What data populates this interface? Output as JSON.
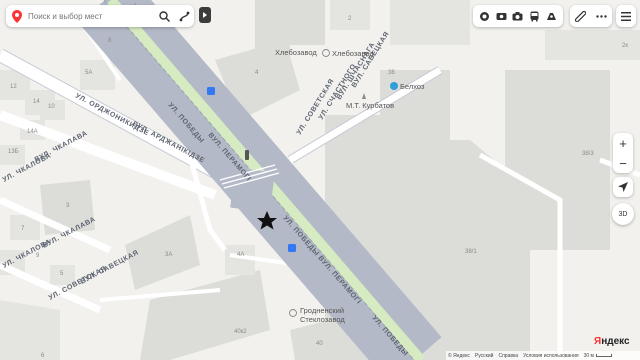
{
  "search": {
    "placeholder": "Поиск и выбор мест"
  },
  "map": {
    "streets": {
      "pobedy_1": "УЛ. ПОБЕДЫ",
      "pobedy_2": "ВУЛ. ПЕРАМОГІ",
      "pobedy_3": "УЛ. ПОБЕДЫ",
      "pobedy_4": "ВУЛ. ПЕРАМОГІ",
      "pobedy_5": "УЛ. ПОБЕДЫ",
      "ordzhonikidze": "УЛ. ОРДЖОНИКИДЗЕ",
      "ardzhanikidze": "ВУЛ. АРДЖАНІКІДЗЕ",
      "chkalova": "УЛ. ЧКАЛОВА",
      "chkalava": "ВУЛ. ЧКАЛАВА",
      "sovetskaya": "УЛ. СОВЕТСКАЯ",
      "savetskaya": "ВУЛ. САВЕЦКАЯ",
      "schastnogo": "УЛ. СЧАСТНОГО",
      "shchasnaga": "ВУЛ. ШЧАСНАГА",
      "chkalova_2": "УЛ. ЧКАЛОВА",
      "chkalava_2": "ВУЛ. ЧКАЛАВА",
      "sovetskaya_2": "УЛ. СОВЕТСКАЯ",
      "savetskaya_2": "ВУЛ. САВЕЦКАЯ"
    },
    "pois": {
      "khlebozavod_1": "Хлебозавод",
      "khlebozavod_2": "Хлебозавод",
      "belkhoz": "Белхоз",
      "kurbatov": "М.Т. Курбатов",
      "grodno_glass_1": "Гродненский",
      "grodno_glass_2": "Стеклозавод"
    },
    "house_numbers": {
      "n2": "2",
      "n4": "4",
      "n12": "12",
      "n14": "14",
      "n10": "10",
      "n14a": "14А",
      "n13b": "13Б",
      "n5a": "5А",
      "n7": "7",
      "n9": "9",
      "n5": "5",
      "n3": "3",
      "n3a": "3А",
      "n4a": "4А",
      "n38": "38",
      "n38_3": "38/3",
      "n38_1": "38/1",
      "n40k2": "40к2",
      "n40": "40",
      "n6": "6",
      "n1": "1",
      "n2k": "2к",
      "n8": "8"
    }
  },
  "layer_buttons": [
    "layers-icon",
    "panorama-icon",
    "photo-icon",
    "transit-icon",
    "traffic-icon"
  ],
  "tool_buttons": [
    "ruler-icon",
    "more-icon"
  ],
  "controls": {
    "zoom_in": "+",
    "zoom_out": "−",
    "three_d": "3D"
  },
  "footer": {
    "copyright": "© Яндекс",
    "language": "Русский",
    "help": "Справка",
    "terms": "Условия использования",
    "scale": "30 м"
  },
  "logo": {
    "first": "Я",
    "rest": "ндекс"
  },
  "colors": {
    "main_road": "#b3b9c6",
    "green_strip": "#d6ebc1",
    "building": "#dededb",
    "ground": "#f2f1ee",
    "pin_red": "#f33"
  }
}
